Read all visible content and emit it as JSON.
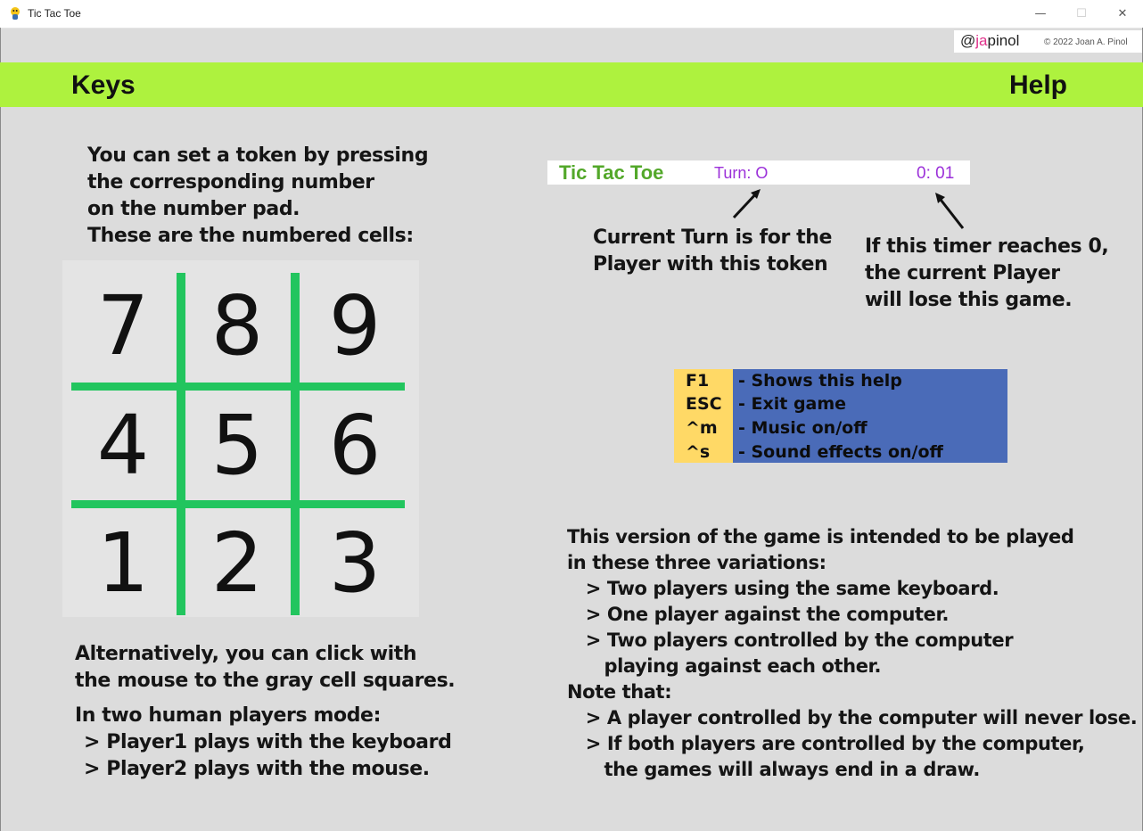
{
  "window": {
    "title": "Tic Tac Toe",
    "minimize": "—",
    "maximize": "☐",
    "close": "✕"
  },
  "credit": {
    "handle_prefix": "@",
    "handle_accent": "ja",
    "handle_rest": "pinol",
    "copyright": "© 2022 Joan A. Pinol"
  },
  "header": {
    "left": "Keys",
    "right": "Help"
  },
  "intro": [
    "You can set a token by pressing",
    "the corresponding number",
    "on the number pad.",
    "These are the numbered cells:"
  ],
  "grid": {
    "cells": [
      "7",
      "8",
      "9",
      "4",
      "5",
      "6",
      "1",
      "2",
      "3"
    ],
    "line_color": "#22c55e"
  },
  "alternative": [
    "Alternatively, you can click with",
    "the mouse to the gray cell squares."
  ],
  "human_mode": {
    "title": "In two human players mode:",
    "lines": [
      "> Player1 plays with the keyboard",
      "> Player2 plays with the mouse."
    ]
  },
  "status_bar": {
    "title": "Tic Tac Toe",
    "turn": "Turn:  O",
    "timer": "0: 01"
  },
  "turn_note": [
    "Current Turn is for the",
    "Player with this token"
  ],
  "timer_note": [
    "If this timer  reaches 0,",
    "the current Player",
    "will lose this game."
  ],
  "keys": [
    {
      "key": "F1",
      "desc": "-  Shows this help"
    },
    {
      "key": "ESC",
      "desc": "-  Exit game"
    },
    {
      "key": "^m",
      "desc": "-   Music  on/off"
    },
    {
      "key": "^s",
      "desc": "-   Sound effects  on/off"
    }
  ],
  "colors": {
    "header": "#aef23e",
    "key_column": "#ffd966",
    "desc_column": "#4a6bb8",
    "status_title": "#53a82a",
    "status_accent": "#9b30d9"
  },
  "version_text": [
    "This version of the game is intended to be played",
    "in these three variations:",
    "   > Two players using the same keyboard.",
    "   > One player against the computer.",
    "   > Two players controlled by the computer",
    "      playing against each other.",
    "Note that:",
    "   > A player controlled by the computer will never lose.",
    "   > If both players are controlled by the computer,",
    "      the games will always end in a draw."
  ]
}
